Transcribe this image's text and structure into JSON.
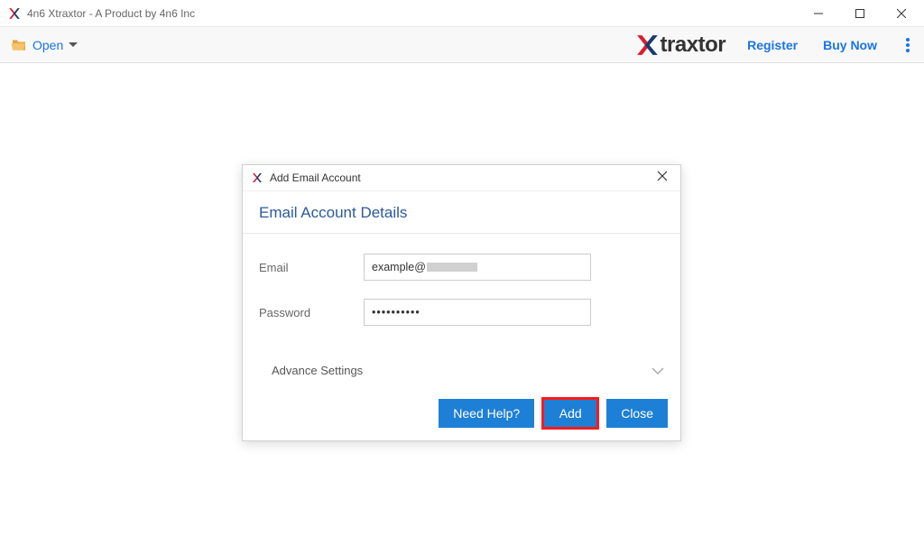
{
  "window": {
    "title": "4n6 Xtraxtor - A Product by 4n6 Inc"
  },
  "toolbar": {
    "open_label": "Open",
    "register_label": "Register",
    "buy_now_label": "Buy Now",
    "brand_text": "traxtor"
  },
  "dialog": {
    "titlebar": "Add Email Account",
    "heading": "Email Account Details",
    "email_label": "Email",
    "email_value": "example@",
    "password_label": "Password",
    "password_value": "••••••••••",
    "advance_label": "Advance Settings",
    "need_help_label": "Need Help?",
    "add_label": "Add",
    "close_label": "Close"
  }
}
